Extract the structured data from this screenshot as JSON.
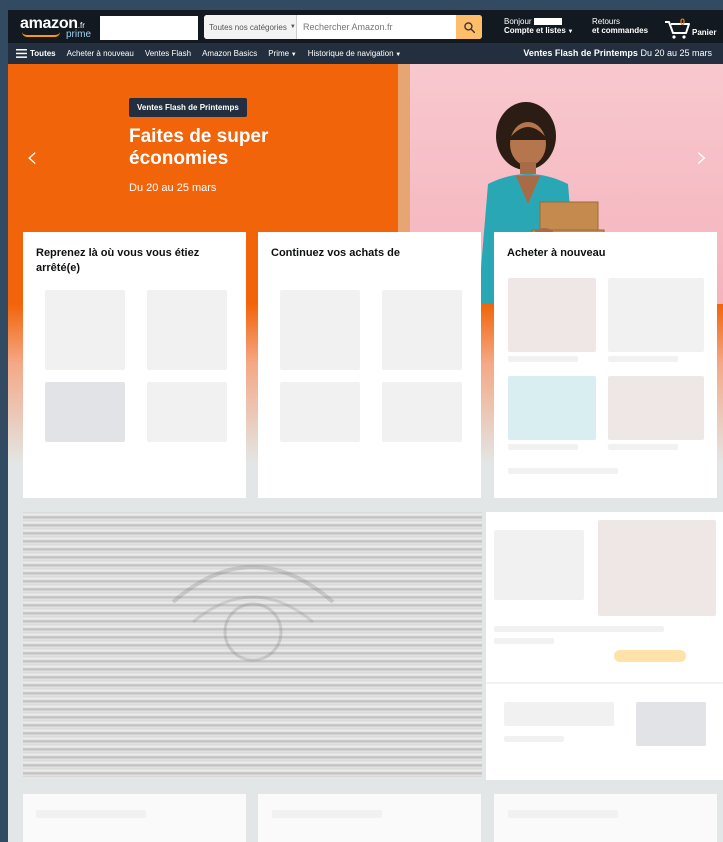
{
  "nav": {
    "logo_text": "amazon",
    "logo_tld": ".fr",
    "logo_prime": "prime",
    "search_category": "Toutes nos catégories",
    "search_placeholder": "Rechercher Amazon.fr",
    "account_greeting": "Bonjour",
    "account_label": "Compte et listes",
    "orders_top": "Retours",
    "orders_label": "et commandes",
    "cart_count": "0",
    "cart_label": "Panier"
  },
  "subnav": {
    "items": [
      "Toutes",
      "Acheter à nouveau",
      "Ventes Flash",
      "Amazon Basics",
      "Prime",
      "Historique de navigation"
    ],
    "promo_title": "Ventes Flash de Printemps",
    "promo_dates": "Du 20 au 25 mars"
  },
  "hero": {
    "tag": "Ventes Flash de Printemps",
    "headline_line1": "Faites de super",
    "headline_line2": "économies",
    "dates": "Du 20 au 25 mars"
  },
  "cards": {
    "resume_title": "Reprenez là où vous vous étiez arrêté(e)",
    "continue_title": "Continuez vos achats de",
    "buyagain_title": "Acheter à nouveau"
  },
  "colors": {
    "nav_bg": "#131921",
    "subnav_bg": "#232f3e",
    "hero_orange": "#f2640a",
    "hero_pink": "#f8c8cf",
    "search_button": "#febd69",
    "cart_count": "#f08804"
  }
}
